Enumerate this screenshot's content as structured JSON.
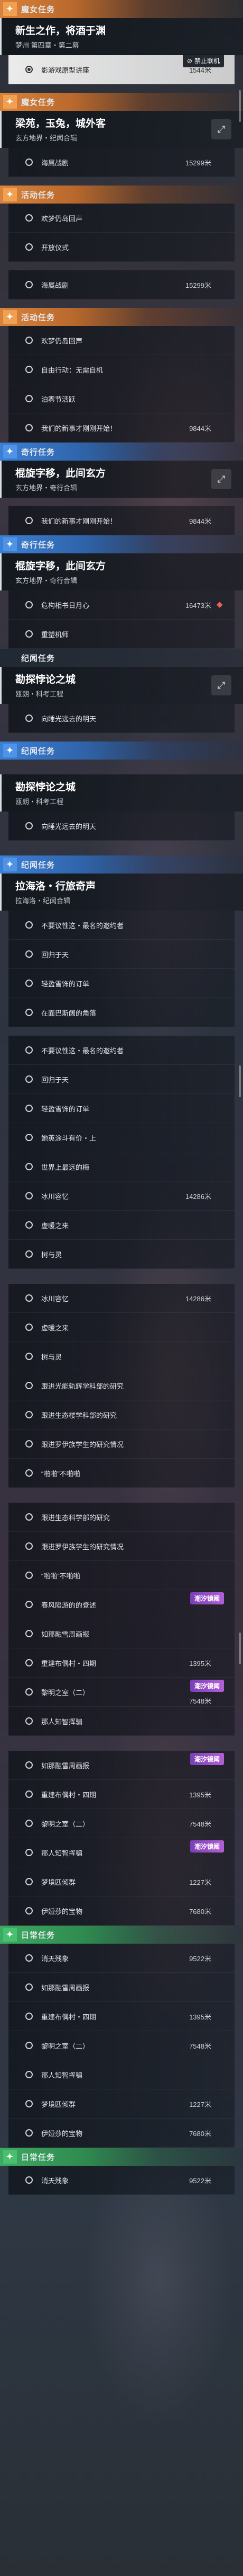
{
  "blocks": [
    {
      "type": "header",
      "color": "orange",
      "icon": "✦",
      "label": "魔女任务"
    },
    {
      "type": "title",
      "title": "新生之作，将酒于渊",
      "sub": "梦州 第四章・第二幕"
    },
    {
      "type": "row",
      "text": "影游戏原型讲座",
      "dist": "1544米",
      "bright": true,
      "popup": "禁止联机"
    },
    {
      "type": "gap"
    },
    {
      "type": "header",
      "color": "orange",
      "icon": "✦",
      "label": "魔女任务"
    },
    {
      "type": "title",
      "title": "梁苑，玉兔，城外客",
      "sub": "玄方地界・纪闻合辑",
      "pin": true
    },
    {
      "type": "row",
      "text": "海属战剧",
      "dist": "15299米"
    },
    {
      "type": "gap"
    },
    {
      "type": "header",
      "color": "orange",
      "icon": "✦",
      "label": "活动任务"
    },
    {
      "type": "row",
      "text": "欢梦仍岛回声"
    },
    {
      "type": "row",
      "text": "开放仪式"
    },
    {
      "type": "gap"
    },
    {
      "type": "row",
      "text": "海属战剧",
      "dist": "15299米"
    },
    {
      "type": "gap"
    },
    {
      "type": "header",
      "color": "orange",
      "icon": "✦",
      "label": "活动任务"
    },
    {
      "type": "row",
      "text": "欢梦仍岛回声"
    },
    {
      "type": "row",
      "text": "自由行动：无需自机"
    },
    {
      "type": "row",
      "text": "泊雾节活跃"
    },
    {
      "type": "row",
      "text": "我们的新事才刚刚开始！",
      "dist": "9844米"
    },
    {
      "type": "header",
      "color": "blue",
      "icon": "✦",
      "label": "奇行任务"
    },
    {
      "type": "title",
      "title": "棍旋字移，此间玄方",
      "sub": "玄方地界・奇行合辑",
      "pin": true
    },
    {
      "type": "gap"
    },
    {
      "type": "row",
      "text": "我们的新事才刚刚开始！",
      "dist": "9844米"
    },
    {
      "type": "header",
      "color": "blue",
      "icon": "✦",
      "label": "奇行任务"
    },
    {
      "type": "title",
      "title": "棍旋字移，此间玄方",
      "sub": "玄方地界・奇行合辑"
    },
    {
      "type": "row",
      "text": "危构相书日月心",
      "dist": "16473米",
      "loc": true
    },
    {
      "type": "row",
      "text": "重塑机师"
    },
    {
      "type": "header",
      "color": "dark",
      "icon": "",
      "label": "纪闻任务"
    },
    {
      "type": "title",
      "title": "勘探悖论之城",
      "sub": "瓯朗・科考工程",
      "pin": true
    },
    {
      "type": "row",
      "text": "向睡光远去的明天"
    },
    {
      "type": "gap"
    },
    {
      "type": "header",
      "color": "blue",
      "icon": "✦",
      "label": "纪闻任务"
    },
    {
      "type": "gapL"
    },
    {
      "type": "title",
      "title": "勘探悖论之城",
      "sub": "瓯朗・科考工程"
    },
    {
      "type": "row",
      "text": "向睡光远去的明天"
    },
    {
      "type": "gapL"
    },
    {
      "type": "header",
      "color": "blue",
      "icon": "✦",
      "label": "纪闻任务"
    },
    {
      "type": "title",
      "title": "拉海洛・行旅奇声",
      "sub": "拉海洛・纪闻合辑"
    },
    {
      "type": "row",
      "text": "不要议性这・最名的邀约者"
    },
    {
      "type": "row",
      "text": "回归于天"
    },
    {
      "type": "row",
      "text": "轻盈雪饰的订单"
    },
    {
      "type": "row",
      "text": "在面巴斯阔的角落"
    },
    {
      "type": "gap"
    },
    {
      "type": "row",
      "text": "不要议性这・最名的邀约者"
    },
    {
      "type": "row",
      "text": "回归于天"
    },
    {
      "type": "row",
      "text": "轻盈雪饰的订单"
    },
    {
      "type": "row",
      "text": "她英涂斗有价・上"
    },
    {
      "type": "row",
      "text": "世界上最远的梅"
    },
    {
      "type": "row",
      "text": "冰川容忆",
      "dist": "14286米"
    },
    {
      "type": "row",
      "text": "虚暖之来"
    },
    {
      "type": "row",
      "text": "树与灵"
    },
    {
      "type": "gapL"
    },
    {
      "type": "row",
      "text": "冰川容忆",
      "dist": "14286米"
    },
    {
      "type": "row",
      "text": "虚暖之来"
    },
    {
      "type": "row",
      "text": "树与灵"
    },
    {
      "type": "row",
      "text": "跟进光能轨辉学科部的研究"
    },
    {
      "type": "row",
      "text": "跟进生态楼学科部的研究"
    },
    {
      "type": "row",
      "text": "跟进罗伊族学生的研究情况"
    },
    {
      "type": "row",
      "text": "“啪啪”不啪啪"
    },
    {
      "type": "gapL"
    },
    {
      "type": "row",
      "text": "跟进生态科学部的研究"
    },
    {
      "type": "row",
      "text": "跟进罗伊族学生的研究情况"
    },
    {
      "type": "row",
      "text": "“啪啪”不啪啪"
    },
    {
      "type": "row",
      "text": "春风陷游的的登述",
      "tag": "潮汐镜阈"
    },
    {
      "type": "row",
      "text": "如那融雪周画报"
    },
    {
      "type": "row",
      "text": "重建布偶村・四期",
      "dist": "1395米"
    },
    {
      "type": "row",
      "text": "黎明之室（二）",
      "dist": "7548米",
      "tag": "潮汐镜阈"
    },
    {
      "type": "row",
      "text": "那人知智挥骗"
    },
    {
      "type": "gapL"
    },
    {
      "type": "row",
      "text": "如那融雪周画报",
      "tag": "潮汐镜阈"
    },
    {
      "type": "row",
      "text": "重建布偶村・四期",
      "dist": "1395米"
    },
    {
      "type": "row",
      "text": "黎明之室（二）",
      "dist": "7548米"
    },
    {
      "type": "row",
      "text": "那人知智挥骗",
      "tag": "潮汐镜阈"
    },
    {
      "type": "row",
      "text": "梦境匹倾群",
      "dist": "1227米"
    },
    {
      "type": "row",
      "text": "伊娅莎的宝物",
      "dist": "7680米"
    },
    {
      "type": "header",
      "color": "green",
      "icon": "✦",
      "label": "日常任务"
    },
    {
      "type": "row",
      "text": "消天残象",
      "dist": "9522米"
    },
    {
      "type": "row",
      "text": "如那融雪周画报"
    },
    {
      "type": "row",
      "text": "重建布偶村・四期",
      "dist": "1395米"
    },
    {
      "type": "row",
      "text": "黎明之室（二）",
      "dist": "7548米"
    },
    {
      "type": "row",
      "text": "那人知智挥骗"
    },
    {
      "type": "row",
      "text": "梦境匹倾群",
      "dist": "1227米"
    },
    {
      "type": "row",
      "text": "伊娅莎的宝物",
      "dist": "7680米"
    },
    {
      "type": "header",
      "color": "green",
      "icon": "✦",
      "label": "日常任务"
    },
    {
      "type": "row",
      "text": "消天残象",
      "dist": "9522米"
    }
  ]
}
